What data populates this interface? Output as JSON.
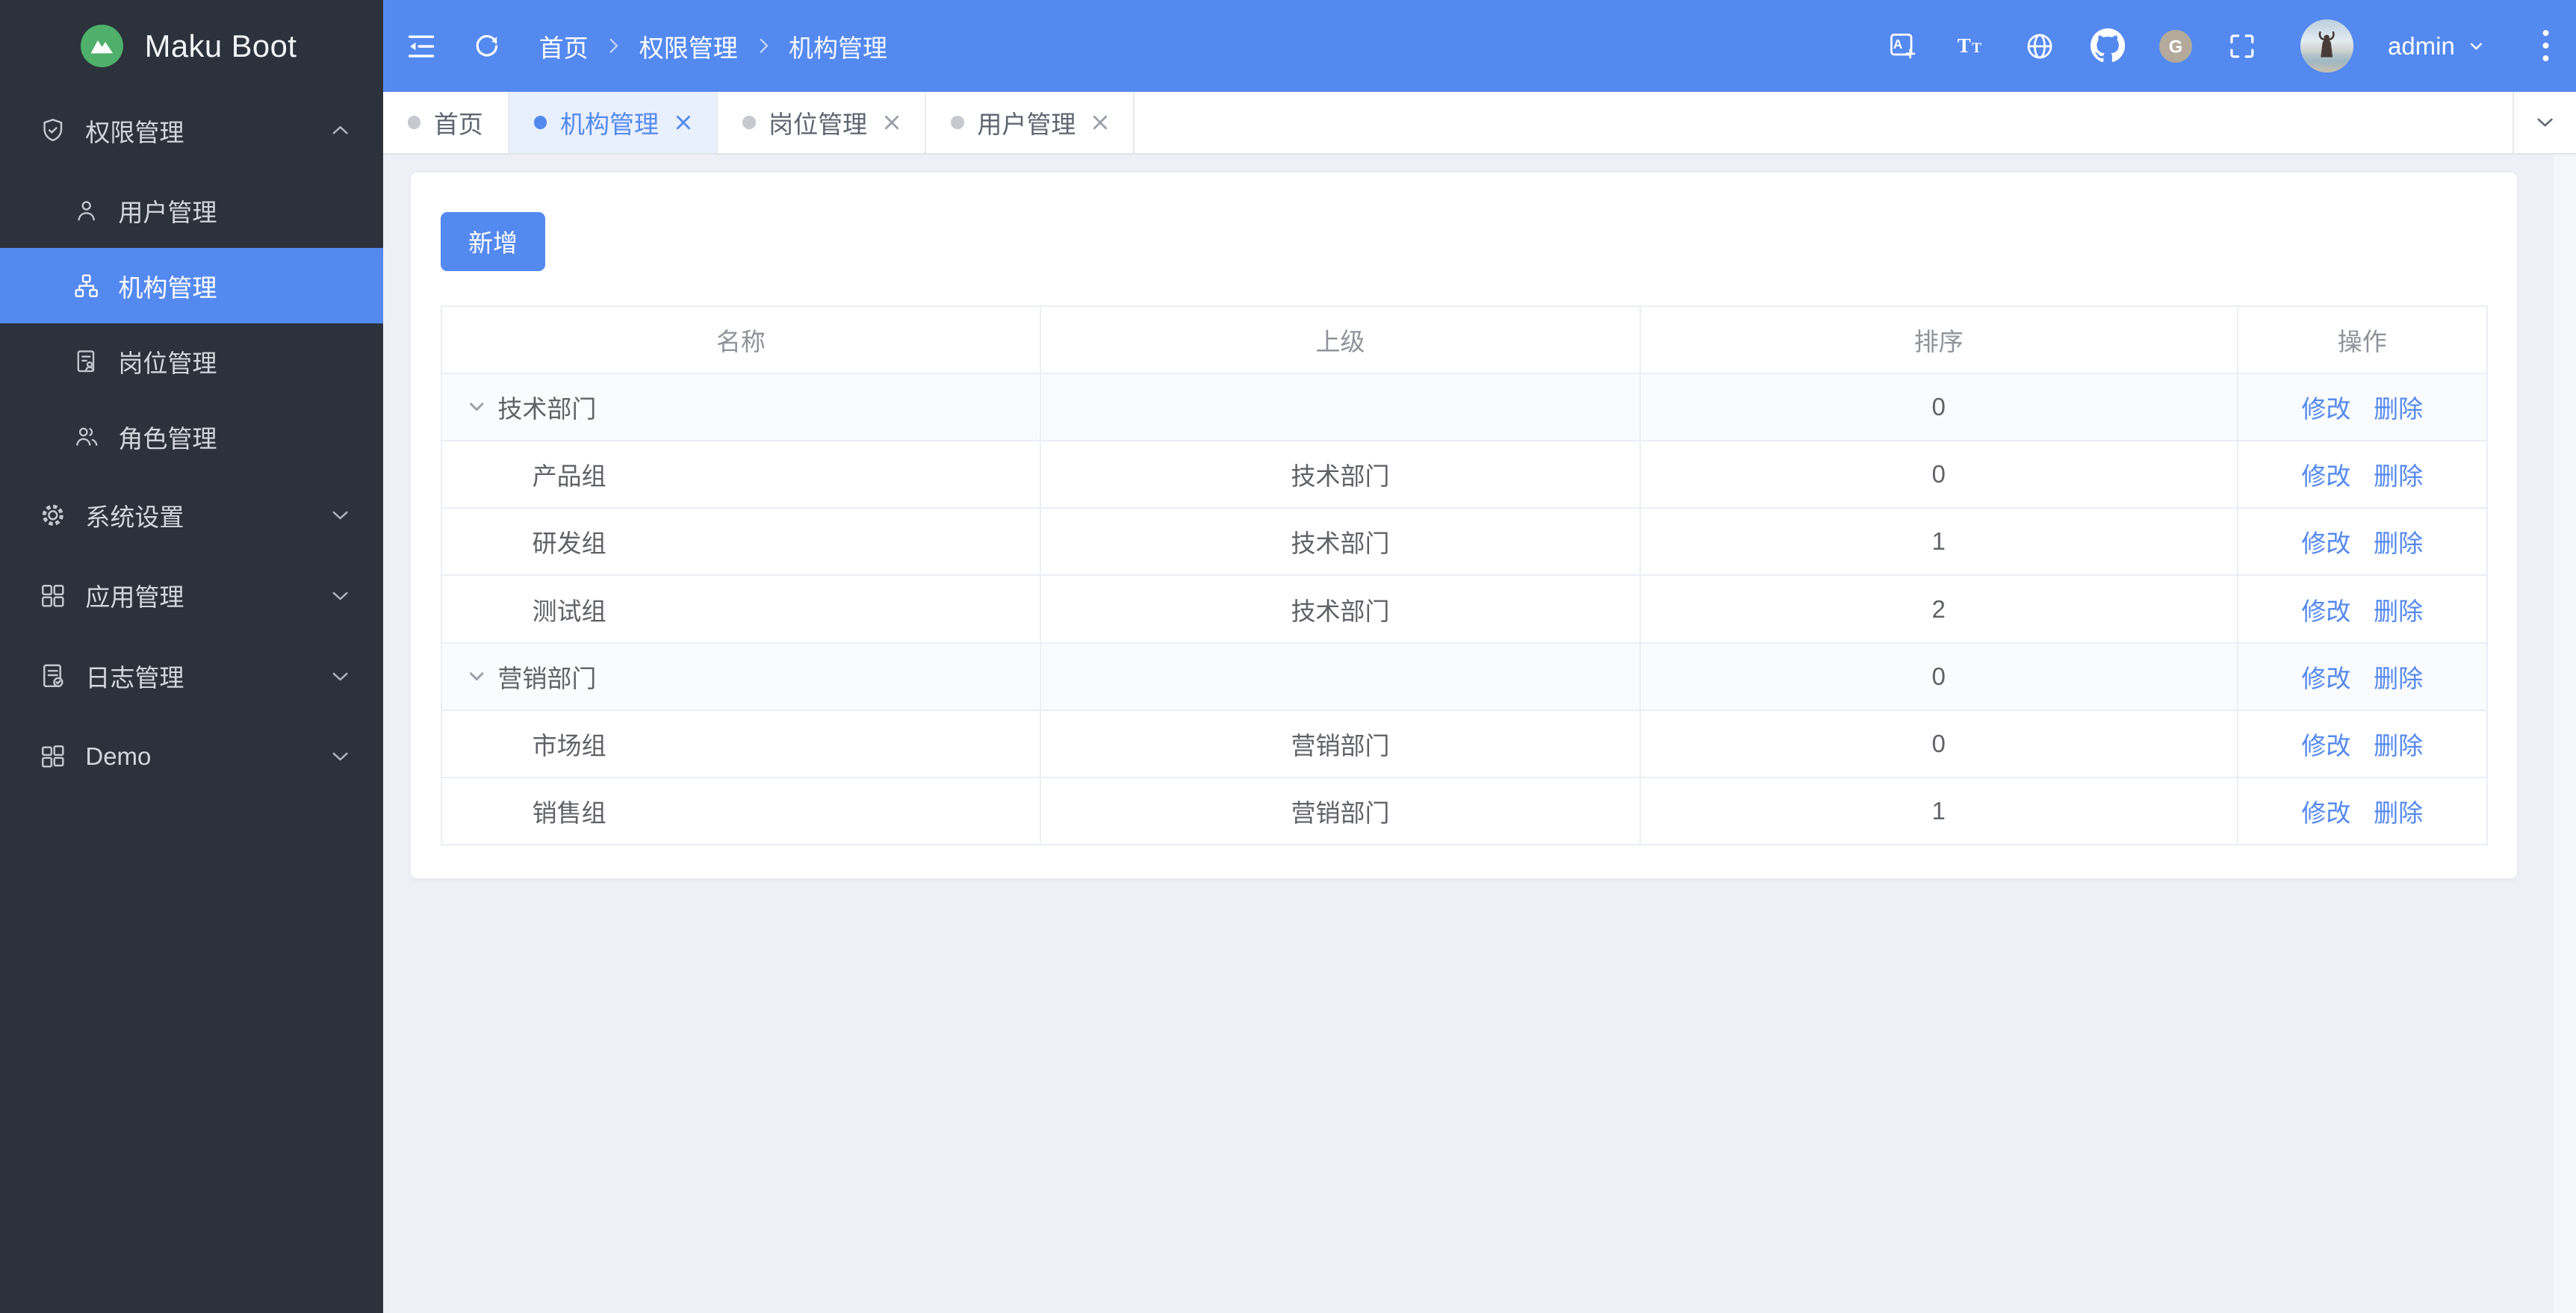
{
  "app": {
    "name": "Maku Boot"
  },
  "colors": {
    "primary": "#5489f0",
    "sidebar_bg": "#2b323c",
    "page_bg": "#eef0f5",
    "active_tab_bg": "#e9f0fd",
    "logo_green": "#4eb06a"
  },
  "sidebar": {
    "groups": [
      {
        "label": "权限管理",
        "state": "expanded",
        "children": [
          {
            "label": "用户管理"
          },
          {
            "label": "机构管理",
            "active": true
          },
          {
            "label": "岗位管理"
          },
          {
            "label": "角色管理"
          }
        ]
      },
      {
        "label": "系统设置",
        "state": "collapsed"
      },
      {
        "label": "应用管理",
        "state": "collapsed"
      },
      {
        "label": "日志管理",
        "state": "collapsed"
      },
      {
        "label": "Demo",
        "state": "collapsed"
      }
    ]
  },
  "header": {
    "breadcrumb": {
      "items": [
        "首页",
        "权限管理",
        "机构管理"
      ]
    },
    "user": {
      "name": "admin"
    }
  },
  "tabbar": {
    "tabs": [
      {
        "label": "首页",
        "active": false,
        "closable": false
      },
      {
        "label": "机构管理",
        "active": true,
        "closable": true
      },
      {
        "label": "岗位管理",
        "active": false,
        "closable": true
      },
      {
        "label": "用户管理",
        "active": false,
        "closable": true
      }
    ]
  },
  "main": {
    "add_button": "新增",
    "table": {
      "columns": [
        "名称",
        "上级",
        "排序",
        "操作"
      ],
      "edit_label": "修改",
      "delete_label": "删除",
      "rows": [
        {
          "name": "技术部门",
          "parent": "",
          "sort": "0",
          "level": 0,
          "expanded": true
        },
        {
          "name": "产品组",
          "parent": "技术部门",
          "sort": "0",
          "level": 1
        },
        {
          "name": "研发组",
          "parent": "技术部门",
          "sort": "1",
          "level": 1
        },
        {
          "name": "测试组",
          "parent": "技术部门",
          "sort": "2",
          "level": 1
        },
        {
          "name": "营销部门",
          "parent": "",
          "sort": "0",
          "level": 0,
          "expanded": true
        },
        {
          "name": "市场组",
          "parent": "营销部门",
          "sort": "0",
          "level": 1
        },
        {
          "name": "销售组",
          "parent": "营销部门",
          "sort": "1",
          "level": 1
        }
      ]
    }
  }
}
